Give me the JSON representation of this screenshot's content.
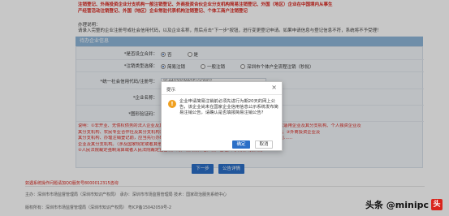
{
  "notice": {
    "lines": [
      "注销登记、外商投资企业分支机构一般注销登记、外商投资合伙企业分支机构简易注销登记、外国（地区）企业在中国境内从事生",
      "产经营活动注销登记、外国（地区）企业常驻代表机构注销登记、个体工商户注销登记"
    ]
  },
  "hint": {
    "title": "办理说明：",
    "body": "请录入完整的企业注册号或社会信用代码，以及企业名称，然后点击\"下一步\"按钮，进行变更登记申请。如果申请信息与登记信息不符，系统将不予受理！"
  },
  "section": {
    "title": "待办企业信息"
  },
  "form": {
    "merge": {
      "label": "*是否设立合并：",
      "options": [
        "否",
        "是"
      ],
      "selected": "否"
    },
    "cancel_type": {
      "label": "*注销类型选择：",
      "options": [
        "简易注销",
        "一般注销",
        "深圳市个体户全流程注销（秒批）"
      ],
      "selected": "简易注销"
    },
    "credit_code": {
      "label": "*统一社会信用代码/注册号：",
      "value": "91440300MA5ELGQN02"
    },
    "company_name": {
      "label": "*企业名称：",
      "value": ""
    },
    "verify_code": {
      "label": "*图形验证码：",
      "value": ""
    }
  },
  "red_note": {
    "lines": [
      "说明：①非开业、无债权债务的法人企业及其分支机构，可以选择以下程序中的\"简易注销\"，办理注销登记（适用企业及其分支机构、个人独资企业及",
      "其分支机构、农民专业合作社及其分支机构）；②其他企业如有异议，应当向登记机关一般注销程序办理登记；③外商投资企业及",
      "其分支机构、办理注销登记前，应当先行办理商务备案或者审批手续；④税务、海关、人社、外汇等相关部门……",
      "企业及其分支机构。（涉及国家规定或者其他部门许可审批的，按相关规定办理。）",
      "②人民法院裁定强制清算或者人民法院裁定宣告破产的，有关清算组、破产管理人可以持人民法院……"
    ]
  },
  "buttons": {
    "next": "下一步",
    "detail": "公告详情"
  },
  "footer": {
    "top": "如遇系统操作问题请加QQ服务号8000012315咨询",
    "org": "主办：深圳市市场监督管理局（深圳市知识产权局）      承办：深圳市市场监督管理局      技术：国家政治服务系统中心",
    "copy": "版权所有：深圳市市场监督管理局（深圳市知识产权局）      粤ICP备15042059号-2"
  },
  "dialog": {
    "title": "提示",
    "message": "企业申请简易注销前必须先进行为期20天的网上公告，该企业尚未在国家企业信用信息公示系统发布简易注销公告，请确认是否填报简易注销公告?",
    "ok": "确定",
    "cancel": "取消"
  },
  "watermark": {
    "text": "头条 @minipc",
    "logo": "头"
  },
  "colors": {
    "accent": "#2b6fc7",
    "warning_red": "#d9241c",
    "section_bar": "#8fb6d9",
    "warn_icon": "#f0a020"
  }
}
